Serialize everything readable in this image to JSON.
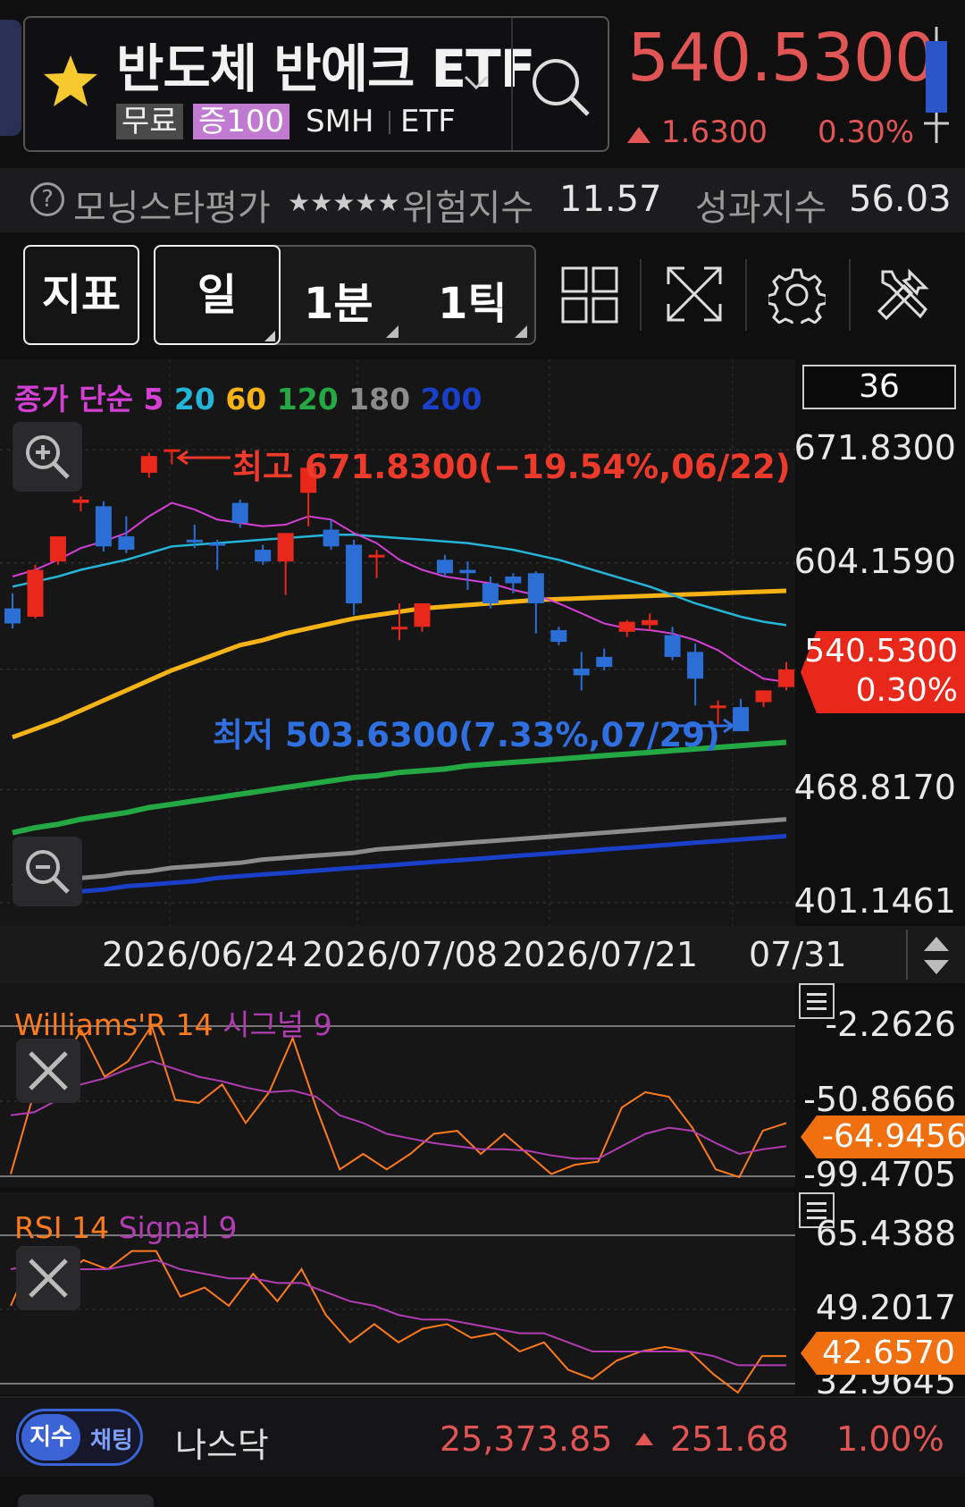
{
  "header": {
    "name": "반도체 반에크 ETF",
    "tags": {
      "free": "무료",
      "margin": "증100",
      "ticker": "SMH",
      "type": "ETF"
    },
    "price": "540.5300",
    "change": "1.6300",
    "change_pct": "0.30%",
    "colors": {
      "up": "#e25555",
      "down": "#2b6fd6"
    }
  },
  "ratings": {
    "morningstar_label": "모닝스타평가",
    "stars": "★★★★★",
    "risk_label": "위험지수",
    "risk_value": "11.57",
    "perf_label": "성과지수",
    "perf_value": "56.03"
  },
  "toolbar": {
    "indicator_label": "지표",
    "periods": [
      "일",
      "1분",
      "1틱"
    ],
    "selected_period": "일",
    "icons": [
      "grid-icon",
      "fullscreen-icon",
      "gear-icon",
      "tools-icon"
    ]
  },
  "main_chart": {
    "legend": {
      "prefix": "종가 단순",
      "ma": [
        "5",
        "20",
        "60",
        "120",
        "180",
        "200"
      ]
    },
    "count_box": "36",
    "high_annotation": "최고 671.8300(−19.54%,06/22)",
    "low_annotation": "최저 503.6300(7.33%,07/29)",
    "current_tag": {
      "price": "540.5300",
      "pct": "0.30%"
    },
    "dates": [
      "2026/06/24",
      "2026/07/08",
      "2026/07/21",
      "07/31"
    ]
  },
  "williams": {
    "title_a": "Williams'R 14",
    "title_b": "시그널 9",
    "current": "-64.9456"
  },
  "rsi": {
    "title_a": "RSI 14",
    "title_b": "Signal 9",
    "current": "42.6570"
  },
  "footer": {
    "toggle_a": "지수",
    "toggle_b": "채팅",
    "index_name": "나스닥",
    "index_value": "25,373.85",
    "index_change": "251.68",
    "index_pct": "1.00%"
  },
  "chart_data": [
    {
      "type": "candlestick",
      "title": "",
      "yticks": [
        "671.8300",
        "604.1590",
        "540.5300",
        "468.8170",
        "401.1461"
      ],
      "ylim": [
        401.1461,
        671.83
      ],
      "ma_periods": [
        5,
        20,
        60,
        120,
        180,
        200
      ],
      "ma_colors": [
        "#d43fd4",
        "#25b5d8",
        "#f5b414",
        "#23a843",
        "#8c8c8c",
        "#1a3fc8"
      ],
      "candles": [
        {
          "o": 577,
          "h": 586,
          "c": 568,
          "l": 565
        },
        {
          "o": 572,
          "h": 603,
          "c": 600,
          "l": 571
        },
        {
          "o": 605,
          "h": 618,
          "c": 620,
          "l": 603
        },
        {
          "o": 640,
          "h": 644,
          "c": 642,
          "l": 635
        },
        {
          "o": 638,
          "h": 641,
          "c": 614,
          "l": 611
        },
        {
          "o": 620,
          "h": 632,
          "c": 612,
          "l": 610
        },
        {
          "o": 658,
          "h": 670,
          "c": 668,
          "l": 655
        },
        {
          "o": 671,
          "h": 671.83,
          "c": 672,
          "l": 663
        },
        {
          "o": 618,
          "h": 627,
          "c": 617,
          "l": 613
        },
        {
          "o": 616,
          "h": 618,
          "c": 615,
          "l": 600
        },
        {
          "o": 640,
          "h": 642,
          "c": 628,
          "l": 625
        },
        {
          "o": 612,
          "h": 615,
          "c": 605,
          "l": 603
        },
        {
          "o": 605,
          "h": 614,
          "c": 622,
          "l": 585
        },
        {
          "o": 646,
          "h": 650,
          "c": 661,
          "l": 626
        },
        {
          "o": 624,
          "h": 630,
          "c": 614,
          "l": 612
        },
        {
          "o": 615,
          "h": 618,
          "c": 580,
          "l": 573
        },
        {
          "o": 608,
          "h": 612,
          "c": 609,
          "l": 595
        },
        {
          "o": 565,
          "h": 580,
          "c": 566,
          "l": 558
        },
        {
          "o": 566,
          "h": 578,
          "c": 580,
          "l": 563
        },
        {
          "o": 606,
          "h": 609,
          "c": 598,
          "l": 596
        },
        {
          "o": 600,
          "h": 605,
          "c": 598,
          "l": 588
        },
        {
          "o": 592,
          "h": 596,
          "c": 580,
          "l": 577
        },
        {
          "o": 596,
          "h": 598,
          "c": 592,
          "l": 586
        },
        {
          "o": 598,
          "h": 599,
          "c": 580,
          "l": 562
        },
        {
          "o": 564,
          "h": 566,
          "c": 557,
          "l": 555
        },
        {
          "o": 541,
          "h": 551,
          "c": 537,
          "l": 528
        },
        {
          "o": 548,
          "h": 553,
          "c": 542,
          "l": 540
        },
        {
          "o": 563,
          "h": 570,
          "c": 569,
          "l": 560
        },
        {
          "o": 567,
          "h": 574,
          "c": 570,
          "l": 564
        },
        {
          "o": 561,
          "h": 566,
          "c": 548,
          "l": 546
        },
        {
          "o": 551,
          "h": 556,
          "c": 535,
          "l": 519
        },
        {
          "o": 518,
          "h": 522,
          "c": 519,
          "l": 508
        },
        {
          "o": 518,
          "h": 523,
          "c": 503.63,
          "l": 503.63
        },
        {
          "o": 521,
          "h": 528,
          "c": 528,
          "l": 518
        },
        {
          "o": 530,
          "h": 545,
          "c": 540.53,
          "l": 528
        }
      ],
      "ma5": [
        596,
        600,
        606,
        613,
        617,
        622,
        632,
        640,
        636,
        630,
        628,
        626,
        627,
        632,
        630,
        622,
        616,
        606,
        600,
        596,
        594,
        592,
        588,
        585,
        580,
        574,
        568,
        565,
        564,
        562,
        558,
        552,
        543,
        535,
        533
      ],
      "ma20": [
        590,
        593,
        596,
        600,
        603,
        606,
        610,
        614,
        615,
        616,
        617,
        618,
        619,
        620,
        621,
        621,
        620,
        619,
        618,
        617,
        616,
        614,
        612,
        609,
        606,
        602,
        598,
        594,
        590,
        585,
        580,
        576,
        572,
        569,
        567
      ],
      "ma60": [
        500,
        505,
        510,
        516,
        522,
        528,
        534,
        540,
        545,
        550,
        555,
        558,
        562,
        565,
        568,
        571,
        573,
        575,
        577,
        578,
        579,
        580,
        581,
        582,
        582.5,
        583,
        583.5,
        584,
        584.5,
        585,
        585.5,
        586,
        586.5,
        587,
        587.5
      ],
      "ma120": [
        443,
        446,
        448,
        451,
        453,
        455,
        458,
        460,
        462,
        464,
        466,
        468,
        470,
        472,
        474,
        476,
        477,
        479,
        480,
        481,
        483,
        484,
        485,
        486,
        487,
        488,
        489,
        490,
        491,
        492,
        493,
        494,
        495,
        496,
        497
      ],
      "ma180": [
        411,
        413,
        414,
        416,
        417,
        419,
        420,
        422,
        423,
        424,
        425,
        427,
        428,
        429,
        430,
        431,
        433,
        434,
        435,
        436,
        437,
        438,
        439,
        440,
        441,
        442,
        443,
        444,
        445,
        446,
        447,
        448,
        449,
        450,
        451
      ],
      "ma200": [
        404,
        405,
        407,
        408,
        409,
        411,
        412,
        413,
        414,
        416,
        417,
        418,
        419,
        420,
        421,
        422,
        423,
        424,
        425,
        426,
        427,
        428,
        429,
        430,
        431,
        432,
        433,
        434,
        435,
        436,
        437,
        438,
        439,
        440,
        441
      ]
    },
    {
      "type": "line",
      "title": "Williams'R 14 시그널 9",
      "yticks": [
        "-2.2626",
        "-50.8666",
        "-99.4705"
      ],
      "ylim": [
        -99.4705,
        -2.2626
      ],
      "series": [
        {
          "name": "Williams'R 14",
          "color": "#ff7a1a",
          "values": [
            -98,
            -45,
            -30,
            -5,
            -35,
            -25,
            -2,
            -50,
            -52,
            -40,
            -65,
            -45,
            -10,
            -55,
            -95,
            -85,
            -95,
            -85,
            -72,
            -70,
            -85,
            -72,
            -85,
            -98,
            -92,
            -90,
            -55,
            -45,
            -48,
            -68,
            -95,
            -100,
            -70,
            -65
          ]
        },
        {
          "name": "시그널 9",
          "color": "#b23cb2",
          "values": [
            -60,
            -58,
            -50,
            -40,
            -36,
            -30,
            -25,
            -30,
            -35,
            -38,
            -42,
            -45,
            -44,
            -48,
            -60,
            -65,
            -72,
            -75,
            -78,
            -80,
            -82,
            -82,
            -83,
            -86,
            -88,
            -88,
            -80,
            -72,
            -68,
            -70,
            -78,
            -85,
            -82,
            -80
          ]
        }
      ]
    },
    {
      "type": "line",
      "title": "RSI 14 Signal 9",
      "yticks": [
        "65.4388",
        "49.2017",
        "32.9645"
      ],
      "ylim": [
        32.9645,
        65.4388
      ],
      "series": [
        {
          "name": "RSI 14",
          "color": "#ff7a1a",
          "values": [
            50,
            62,
            56,
            60,
            58,
            62,
            62,
            52,
            54,
            50,
            57,
            51,
            58,
            48,
            42,
            46,
            42,
            45,
            46,
            43,
            44,
            40,
            42,
            36,
            34,
            38,
            40,
            41,
            40,
            35,
            31,
            39,
            39
          ]
        },
        {
          "name": "Signal 9",
          "color": "#b23cb2",
          "values": [
            58,
            59,
            58,
            58,
            58,
            59,
            60,
            58,
            57,
            56,
            56,
            55,
            55,
            53,
            51,
            50,
            48,
            47,
            47,
            46,
            45,
            44,
            44,
            42,
            40,
            40,
            40,
            40,
            40,
            39,
            37,
            37,
            37
          ]
        }
      ]
    }
  ]
}
